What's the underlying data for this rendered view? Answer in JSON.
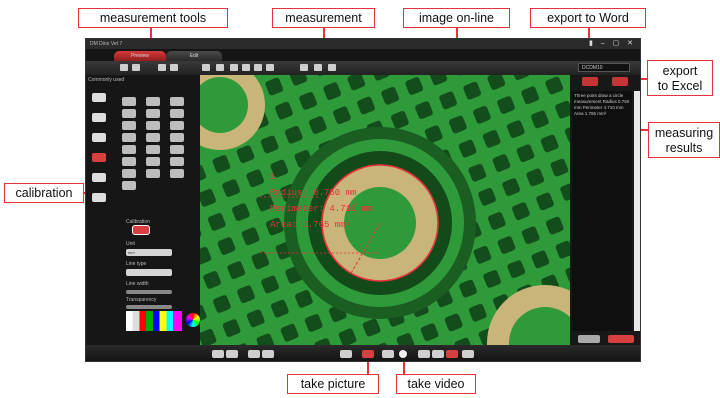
{
  "callouts": {
    "measurement_tools": "measurement tools",
    "measurement": "measurement",
    "image_online": "image on-line",
    "export_word": "export to Word",
    "export_excel_line1": "export",
    "export_excel_line2": "to Excel",
    "measuring_line1": "measuring",
    "measuring_line2": "results",
    "calibration": "calibration",
    "take_picture": "take picture",
    "take_video": "take video"
  },
  "app": {
    "title": "DM Dino Vet 7",
    "tab_preview": "Preview",
    "tab_edit": "Edit",
    "selector": "DCDM10",
    "common_used": "Commonly used",
    "panel": {
      "calibration": "Calibration",
      "unit": "Unit",
      "unit_value": "mm",
      "line_type": "Line type",
      "line_width": "Line width",
      "transparency": "Transparency",
      "color": "Color"
    },
    "results_text": "Three point draw a circle measurement Radius 0.750 mm Perimeter 4.710 mm Area 1.765 mm²"
  },
  "overlay": {
    "index": "1",
    "radius": "Radius: 0.750 mm",
    "perimeter": "Perimeter: 4.710 mm",
    "area": "Area: 1.765 mm²"
  },
  "colors": {
    "accent_red": "#e8323a",
    "pcb_green": "#2f9a3a",
    "pad_gold": "#c9b47a"
  }
}
